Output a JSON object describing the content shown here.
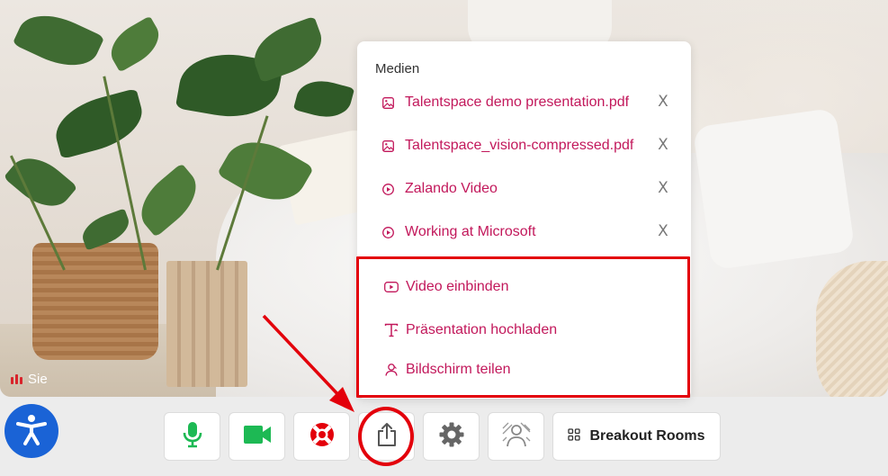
{
  "video": {
    "self_label": "Sie"
  },
  "media_panel": {
    "title": "Medien",
    "items": [
      {
        "label": "Talentspace demo presentation.pdf",
        "icon": "image-icon"
      },
      {
        "label": "Talentspace_vision-compressed.pdf",
        "icon": "image-icon"
      },
      {
        "label": "Zalando Video",
        "icon": "play-circle-icon"
      },
      {
        "label": "Working at Microsoft",
        "icon": "play-circle-icon"
      }
    ],
    "close_glyph": "X",
    "actions": [
      {
        "label": "Video einbinden",
        "icon": "youtube-icon"
      },
      {
        "label": "Präsentation hochladen",
        "icon": "upload-text-icon"
      },
      {
        "label": "Bildschirm teilen",
        "icon": "users-screen-icon"
      }
    ]
  },
  "toolbar": {
    "accessibility_icon": "accessibility-icon",
    "buttons": [
      {
        "icon": "microphone-icon",
        "color": "#1db954"
      },
      {
        "icon": "camera-icon",
        "color": "#1db954"
      },
      {
        "icon": "lifebuoy-icon",
        "color": "#e3000b"
      },
      {
        "icon": "share-upload-icon",
        "color": "#555555"
      },
      {
        "icon": "gear-icon",
        "color": "#555555"
      },
      {
        "icon": "background-blur-icon",
        "color": "#555555"
      }
    ],
    "breakout_label": "Breakout Rooms"
  },
  "colors": {
    "accent": "#c2185b",
    "highlight": "#e3000b",
    "accessibility_blue": "#1a63d6",
    "active_green": "#1db954"
  }
}
